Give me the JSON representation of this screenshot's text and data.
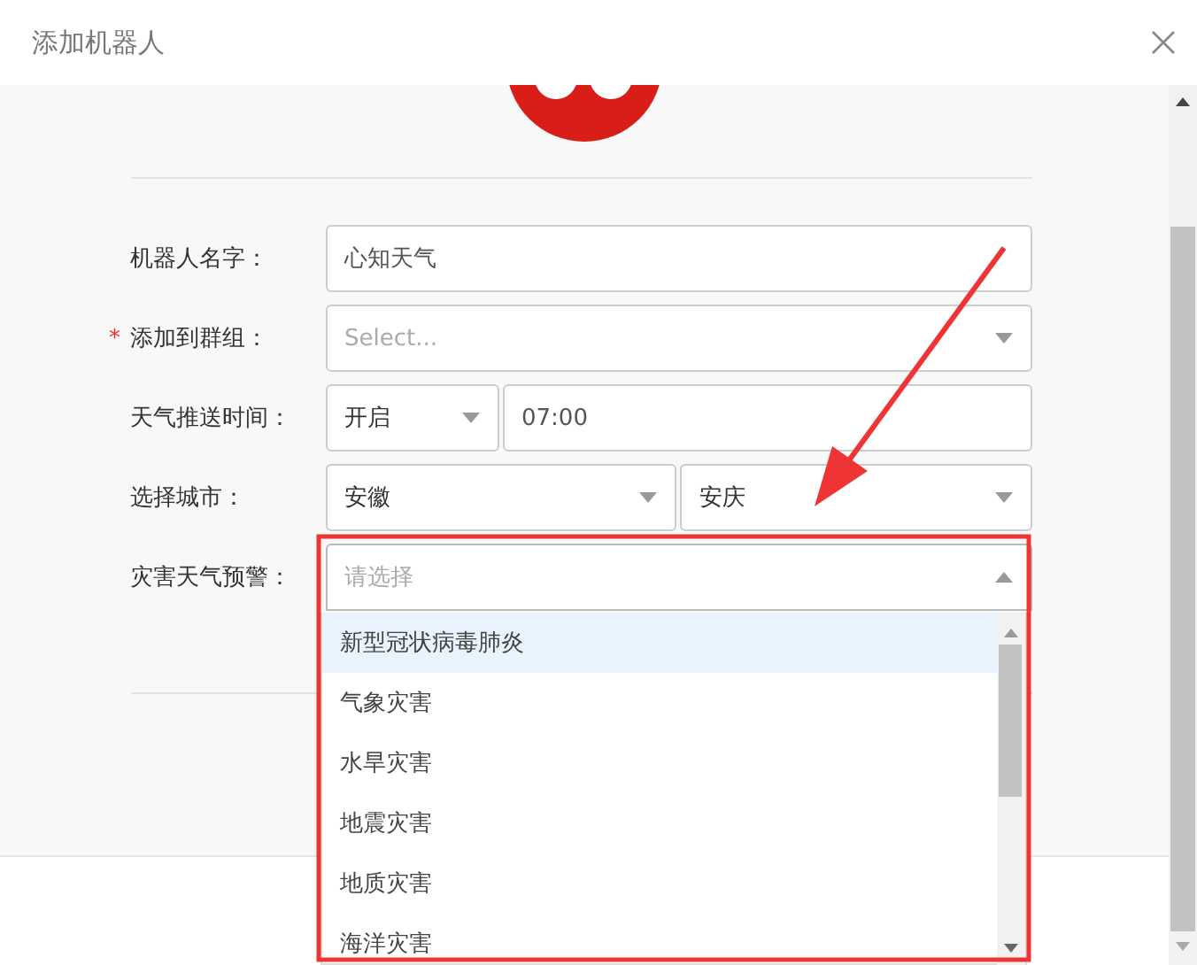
{
  "window": {
    "title": "添加机器人"
  },
  "form": {
    "rows": [
      {
        "label": "机器人名字：",
        "fields": [
          {
            "kind": "input",
            "value": "心知天气"
          }
        ]
      },
      {
        "label": "添加到群组：",
        "marker": "*",
        "fields": [
          {
            "kind": "select",
            "placeholder": "Select..."
          }
        ]
      },
      {
        "label": "天气推送时间：",
        "fields": [
          {
            "kind": "short-select",
            "value": "开启"
          },
          {
            "kind": "input",
            "value": "07:00"
          }
        ]
      },
      {
        "label": "选择城市：",
        "fields": [
          {
            "kind": "select",
            "value": "安徽"
          },
          {
            "kind": "select",
            "value": "安庆"
          }
        ]
      },
      {
        "label": "灾害天气预警：",
        "fields": [
          {
            "kind": "select",
            "placeholder": "请选择",
            "open": true
          }
        ]
      }
    ]
  },
  "dropdown": {
    "options": [
      {
        "label": "新型冠状病毒肺炎",
        "selected": true
      },
      {
        "label": "气象灾害",
        "selected": false
      },
      {
        "label": "水旱灾害",
        "selected": false
      },
      {
        "label": "地震灾害",
        "selected": false
      },
      {
        "label": "地质灾害",
        "selected": false
      },
      {
        "label": "海洋灾害",
        "selected": false
      }
    ]
  }
}
